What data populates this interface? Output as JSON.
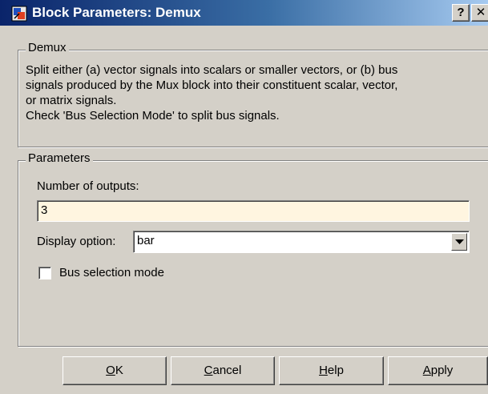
{
  "window": {
    "title": "Block Parameters: Demux",
    "help_button": "?",
    "close_button": "✕"
  },
  "demux_group": {
    "label": "Demux",
    "description_lines": [
      "Split either (a) vector signals into scalars or smaller vectors, or (b) bus",
      "signals produced by the Mux block into their constituent scalar, vector,",
      "or matrix signals.",
      "Check 'Bus Selection Mode' to split bus signals."
    ]
  },
  "parameters_group": {
    "label": "Parameters",
    "num_outputs_label": "Number of outputs:",
    "num_outputs_value": "3",
    "display_option_label": "Display option:",
    "display_option_value": "bar",
    "bus_selection_label": "Bus selection mode",
    "bus_selection_checked": false
  },
  "buttons": {
    "ok": {
      "mnemonic": "O",
      "rest": "K"
    },
    "cancel": {
      "mnemonic": "C",
      "rest": "ancel"
    },
    "help": {
      "mnemonic": "H",
      "rest": "elp"
    },
    "apply": {
      "mnemonic": "A",
      "rest": "pply"
    }
  },
  "icons": {
    "title_icon": "simulink-block-icon",
    "dropdown_icon": "chevron-down-icon"
  },
  "colors": {
    "titlebar_start": "#0a246a",
    "titlebar_end": "#a6caf0",
    "dialog_face": "#d4d0c8",
    "input_highlight": "#fff5e0"
  }
}
